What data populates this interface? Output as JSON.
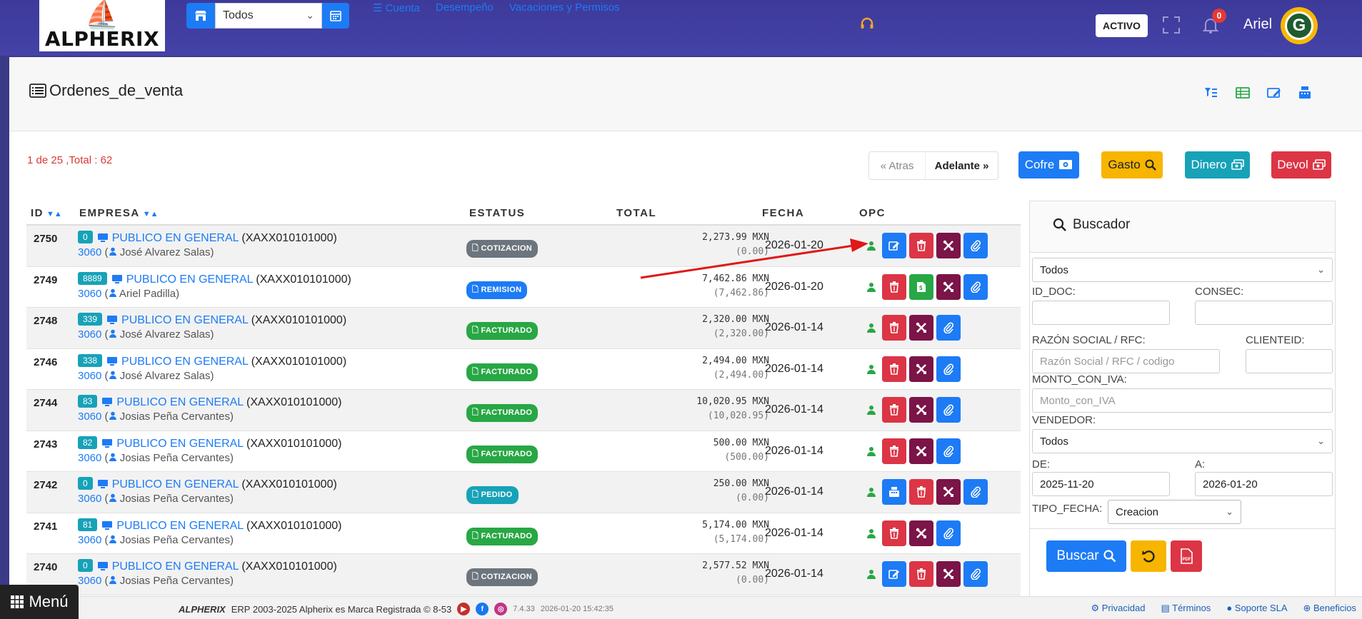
{
  "header": {
    "logo_text": "ALPHERIX",
    "store_filter": "Todos",
    "links": [
      "☰ Cuenta",
      "Desempeño",
      "Vacaciones y Permisos"
    ],
    "status": "ACTIVO",
    "notifications": "0",
    "user": "Ariel",
    "avatar_letter": "G"
  },
  "page": {
    "title": "Ordenes_de_venta",
    "pager_info": "1 de 25 ,Total : 62",
    "prev": "« Atras",
    "next": "Adelante »"
  },
  "actions": {
    "cofre": "Cofre",
    "gasto": "Gasto",
    "dinero": "Dinero",
    "devol": "Devol"
  },
  "table": {
    "columns": [
      "ID",
      "EMPRESA",
      "ESTATUS",
      "TOTAL",
      "FECHA",
      "OPC"
    ],
    "rows": [
      {
        "id": "2750",
        "badge": "0",
        "empresa": "PUBLICO EN GENERAL",
        "rfc": "(XAXX010101000)",
        "cid": "3060",
        "vendedor": "José Alvarez Salas",
        "status": "COTIZACION",
        "total": "2,273.99 MXN",
        "pagado": "(0.00)",
        "fecha": "2026-01-20"
      },
      {
        "id": "2749",
        "badge": "8889",
        "empresa": "PUBLICO EN GENERAL",
        "rfc": "(XAXX010101000)",
        "cid": "3060",
        "vendedor": "Ariel Padilla",
        "status": "REMISION",
        "total": "7,462.86 MXN",
        "pagado": "(7,462.86)",
        "fecha": "2026-01-20"
      },
      {
        "id": "2748",
        "badge": "339",
        "empresa": "PUBLICO EN GENERAL",
        "rfc": "(XAXX010101000)",
        "cid": "3060",
        "vendedor": "José Alvarez Salas",
        "status": "FACTURADO",
        "total": "2,320.00 MXN",
        "pagado": "(2,320.00)",
        "fecha": "2026-01-14"
      },
      {
        "id": "2746",
        "badge": "338",
        "empresa": "PUBLICO EN GENERAL",
        "rfc": "(XAXX010101000)",
        "cid": "3060",
        "vendedor": "José Alvarez Salas",
        "status": "FACTURADO",
        "total": "2,494.00 MXN",
        "pagado": "(2,494.00)",
        "fecha": "2026-01-14"
      },
      {
        "id": "2744",
        "badge": "83",
        "empresa": "PUBLICO EN GENERAL",
        "rfc": "(XAXX010101000)",
        "cid": "3060",
        "vendedor": "Josias Peña Cervantes",
        "status": "FACTURADO",
        "total": "10,020.95 MXN",
        "pagado": "(10,020.95)",
        "fecha": "2026-01-14"
      },
      {
        "id": "2743",
        "badge": "82",
        "empresa": "PUBLICO EN GENERAL",
        "rfc": "(XAXX010101000)",
        "cid": "3060",
        "vendedor": "Josias Peña Cervantes",
        "status": "FACTURADO",
        "total": "500.00 MXN",
        "pagado": "(500.00)",
        "fecha": "2026-01-14"
      },
      {
        "id": "2742",
        "badge": "0",
        "empresa": "PUBLICO EN GENERAL",
        "rfc": "(XAXX010101000)",
        "cid": "3060",
        "vendedor": "Josias Peña Cervantes",
        "status": "PEDIDO",
        "total": "250.00 MXN",
        "pagado": "(0.00)",
        "fecha": "2026-01-14"
      },
      {
        "id": "2741",
        "badge": "81",
        "empresa": "PUBLICO EN GENERAL",
        "rfc": "(XAXX010101000)",
        "cid": "3060",
        "vendedor": "Josias Peña Cervantes",
        "status": "FACTURADO",
        "total": "5,174.00 MXN",
        "pagado": "(5,174.00)",
        "fecha": "2026-01-14"
      },
      {
        "id": "2740",
        "badge": "0",
        "empresa": "PUBLICO EN GENERAL",
        "rfc": "(XAXX010101000)",
        "cid": "3060",
        "vendedor": "Josias Peña Cervantes",
        "status": "COTIZACION",
        "total": "2,577.52 MXN",
        "pagado": "(0.00)",
        "fecha": "2026-01-14"
      }
    ]
  },
  "buscador": {
    "title": "Buscador",
    "tipo_doc": "Todos",
    "id_doc_label": "ID_DOC:",
    "consec_label": "CONSEC:",
    "razon_label": "RAZÓN SOCIAL / RFC:",
    "razon_placeholder": "Razón Social / RFC / codigo",
    "clienteid_label": "CLIENTEID:",
    "monto_label": "MONTO_CON_IVA:",
    "monto_placeholder": "Monto_con_IVA",
    "vendedor_label": "VENDEDOR:",
    "vendedor_value": "Todos",
    "de_label": "DE:",
    "de_value": "2025-11-20",
    "a_label": "A:",
    "a_value": "2026-01-20",
    "tipo_fecha_label": "TIPO_FECHA:",
    "tipo_fecha_value": "Creacion",
    "buscar": "Buscar"
  },
  "footer": {
    "menu": "Menú",
    "brand": "ALPHERIX",
    "copyright": "ERP 2003-2025 Alpherix es Marca Registrada © 8-53",
    "version": "7.4.33",
    "datetime": "2026-01-20 15:42:35",
    "links": [
      "Privacidad",
      "Términos",
      "Soporte SLA",
      "Beneficios"
    ]
  },
  "colors": {
    "primary": "#1d7bf5",
    "danger": "#dc3545",
    "success": "#28a745",
    "warning": "#f7b500",
    "info": "#17a2b8",
    "purple": "#7b1447",
    "secondary": "#6c757d",
    "header": "#4542a8"
  },
  "status_colors": {
    "COTIZACION": "#6c757d",
    "REMISION": "#1d7bf5",
    "FACTURADO": "#28a745",
    "PEDIDO": "#17a2b8"
  }
}
